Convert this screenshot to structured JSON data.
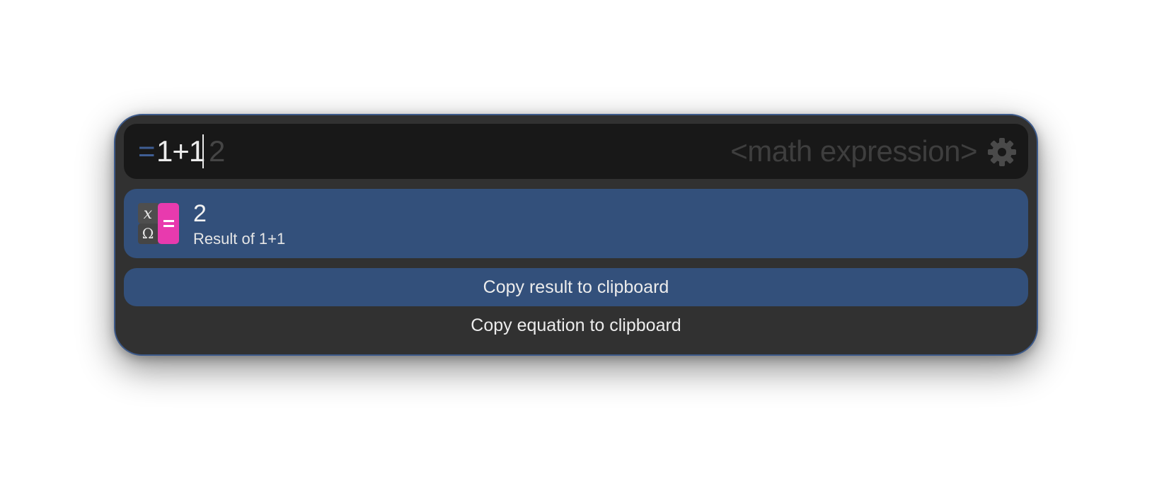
{
  "input": {
    "trigger": "=",
    "query": "1+1",
    "completion": "2",
    "placeholder": "<math expression>",
    "settings_icon": "gear-icon"
  },
  "result": {
    "icon": "calculator-app-icon",
    "title": "2",
    "subtitle": "Result of 1+1"
  },
  "actions": [
    {
      "label": "Copy result to clipboard",
      "selected": true
    },
    {
      "label": "Copy equation to clipboard",
      "selected": false
    }
  ],
  "colors": {
    "window_bg": "#313131",
    "input_bg": "#181818",
    "selection": "#33507b",
    "trigger": "#3f5e94",
    "accent_pink": "#e83aae"
  }
}
